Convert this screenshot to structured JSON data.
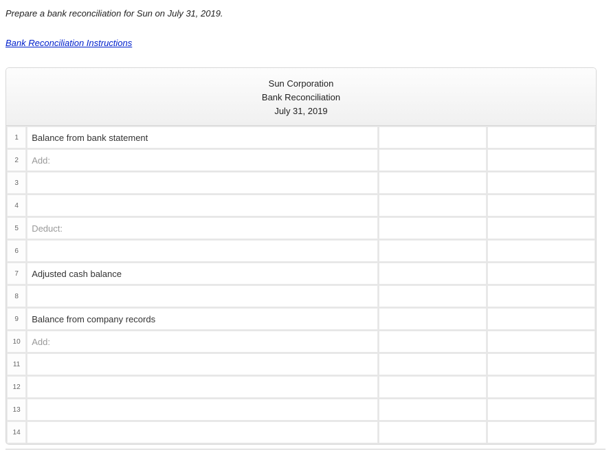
{
  "instruction": "Prepare a bank reconciliation for Sun on July 31, 2019.",
  "link_text": "Bank Reconciliation Instructions",
  "header": {
    "company": "Sun Corporation",
    "title": "Bank Reconciliation",
    "date": "July 31, 2019"
  },
  "rows": [
    {
      "num": "1",
      "text": "Balance from bank statement",
      "muted": false
    },
    {
      "num": "2",
      "text": "Add:",
      "muted": true
    },
    {
      "num": "3",
      "text": "",
      "muted": false
    },
    {
      "num": "4",
      "text": "",
      "muted": false
    },
    {
      "num": "5",
      "text": "Deduct:",
      "muted": true
    },
    {
      "num": "6",
      "text": "",
      "muted": false
    },
    {
      "num": "7",
      "text": "Adjusted cash balance",
      "muted": false
    },
    {
      "num": "8",
      "text": "",
      "muted": false
    },
    {
      "num": "9",
      "text": "Balance from company records",
      "muted": false
    },
    {
      "num": "10",
      "text": "Add:",
      "muted": true
    },
    {
      "num": "11",
      "text": "",
      "muted": false
    },
    {
      "num": "12",
      "text": "",
      "muted": false
    },
    {
      "num": "13",
      "text": "",
      "muted": false
    },
    {
      "num": "14",
      "text": "",
      "muted": false
    }
  ]
}
